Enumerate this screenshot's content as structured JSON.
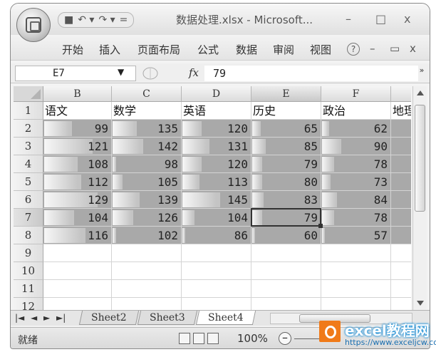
{
  "titlebar": {
    "title": "数据处理.xlsx - Microsoft...",
    "qat_icons": [
      "save-icon",
      "undo-icon",
      "redo-icon",
      "customize-icon"
    ],
    "qat_glyphs": [
      "■",
      "↶ ▾",
      "↷ ▾",
      "="
    ],
    "minimize": "–",
    "maximize": "□",
    "close": "x"
  },
  "ribbon": {
    "tabs": [
      "开始",
      "插入",
      "页面布局",
      "公式",
      "数据",
      "审阅",
      "视图"
    ],
    "help": "?",
    "minimize": "–",
    "restore": "▭",
    "close": "x"
  },
  "formula_bar": {
    "name_box": "E7",
    "fx_label": "fx",
    "value": "79",
    "expand": "»"
  },
  "sheet": {
    "columns": [
      "B",
      "C",
      "D",
      "E",
      "F"
    ],
    "partial_column_header": "",
    "rows": [
      "1",
      "2",
      "3",
      "4",
      "5",
      "6",
      "7",
      "8",
      "9",
      "10",
      "11",
      "12"
    ],
    "headers": [
      "语文",
      "数学",
      "英语",
      "历史",
      "政治",
      "地理"
    ],
    "data": [
      [
        99,
        135,
        120,
        65,
        62
      ],
      [
        121,
        142,
        131,
        85,
        90
      ],
      [
        108,
        98,
        120,
        79,
        78
      ],
      [
        112,
        105,
        113,
        80,
        73
      ],
      [
        129,
        139,
        145,
        83,
        84
      ],
      [
        104,
        126,
        104,
        79,
        78
      ],
      [
        116,
        102,
        86,
        60,
        57
      ]
    ],
    "data_bar_fill": [
      [
        0.42,
        0.35,
        0.28,
        0.12,
        0.1
      ],
      [
        0.72,
        0.45,
        0.4,
        0.2,
        0.28
      ],
      [
        0.5,
        0.05,
        0.28,
        0.15,
        0.18
      ],
      [
        0.55,
        0.15,
        0.25,
        0.15,
        0.12
      ],
      [
        0.8,
        0.4,
        0.55,
        0.17,
        0.22
      ],
      [
        0.45,
        0.3,
        0.18,
        0.15,
        0.18
      ],
      [
        0.62,
        0.05,
        0.02,
        0.02,
        0.02
      ]
    ],
    "active_cell": "E7",
    "selected_column": "E",
    "selected_row": "7"
  },
  "sheet_tabs": {
    "nav": [
      "|◄",
      "◄",
      "►",
      "►|"
    ],
    "tabs": [
      "Sheet2",
      "Sheet3",
      "Sheet4"
    ],
    "active": "Sheet4"
  },
  "status_bar": {
    "status": "就绪",
    "zoom": "100%",
    "zoom_out": "–"
  },
  "watermark": {
    "brand": "excel教程网",
    "url": "https://www.exceljcw.com"
  }
}
